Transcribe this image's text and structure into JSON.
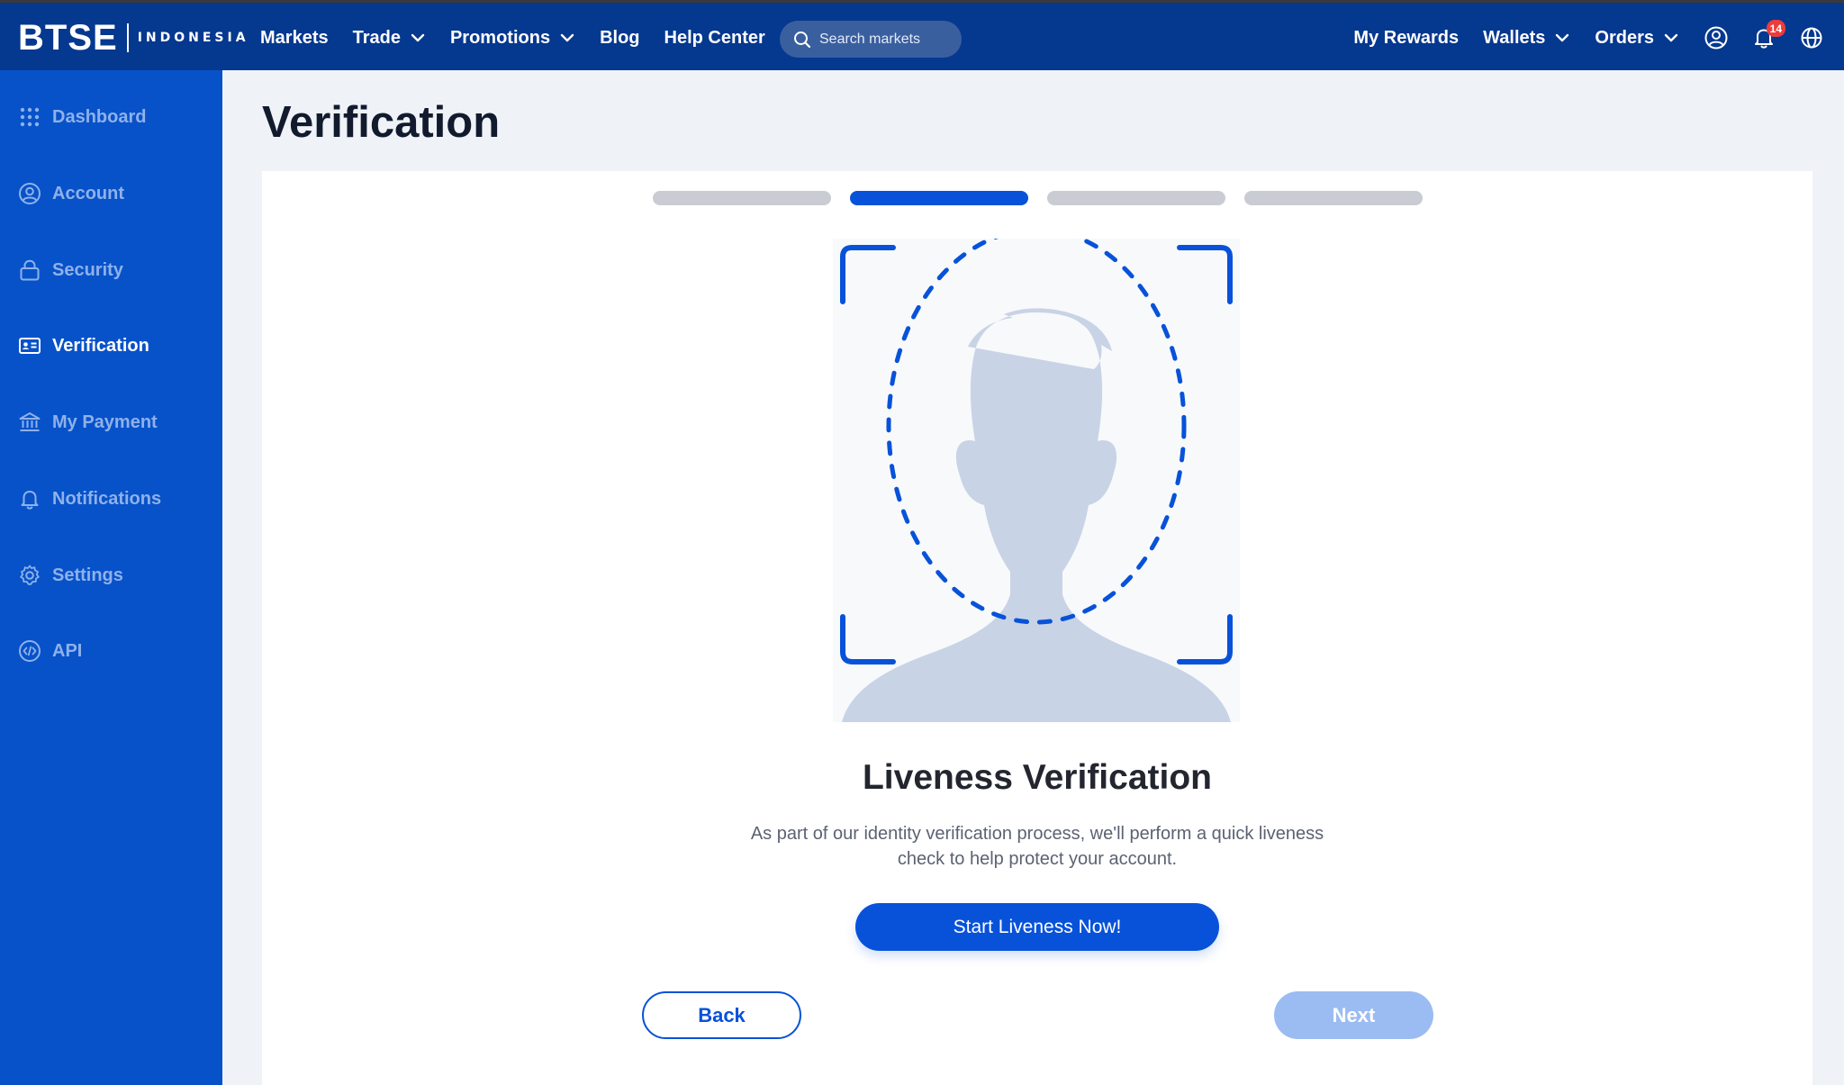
{
  "brand": {
    "name": "BTSE",
    "region": "INDONESIA"
  },
  "nav": {
    "markets": "Markets",
    "trade": "Trade",
    "promotions": "Promotions",
    "blog": "Blog",
    "help_center": "Help Center",
    "search_placeholder": "Search markets",
    "my_rewards": "My Rewards",
    "wallets": "Wallets",
    "orders": "Orders",
    "notification_count": "14",
    "icons": [
      "search-icon",
      "chevron-down-icon",
      "user-circle-icon",
      "bell-icon",
      "globe-icon"
    ]
  },
  "sidebar": {
    "items": [
      {
        "label": "Dashboard",
        "icon": "grid-dots-icon"
      },
      {
        "label": "Account",
        "icon": "user-circle-icon"
      },
      {
        "label": "Security",
        "icon": "lock-icon"
      },
      {
        "label": "Verification",
        "icon": "id-card-icon",
        "active": true
      },
      {
        "label": "My Payment",
        "icon": "bank-icon"
      },
      {
        "label": "Notifications",
        "icon": "bell-icon"
      },
      {
        "label": "Settings",
        "icon": "gear-icon"
      },
      {
        "label": "API",
        "icon": "code-icon"
      }
    ]
  },
  "page": {
    "title": "Verification"
  },
  "stepper": {
    "total_steps": 4,
    "current_step": 2
  },
  "liveness": {
    "title": "Liveness Verification",
    "description": "As part of our identity verification process, we'll perform a quick liveness check to help protect your account.",
    "start_label": "Start Liveness Now!"
  },
  "actions": {
    "back_label": "Back",
    "next_label": "Next",
    "next_enabled": false
  },
  "colors": {
    "topbar": "#05388f",
    "sidebar": "#0752c9",
    "accent": "#0752d9",
    "step_inactive": "#c9ccd3",
    "next_disabled": "#9bbcf2",
    "silhouette": "#c8d3e6"
  }
}
